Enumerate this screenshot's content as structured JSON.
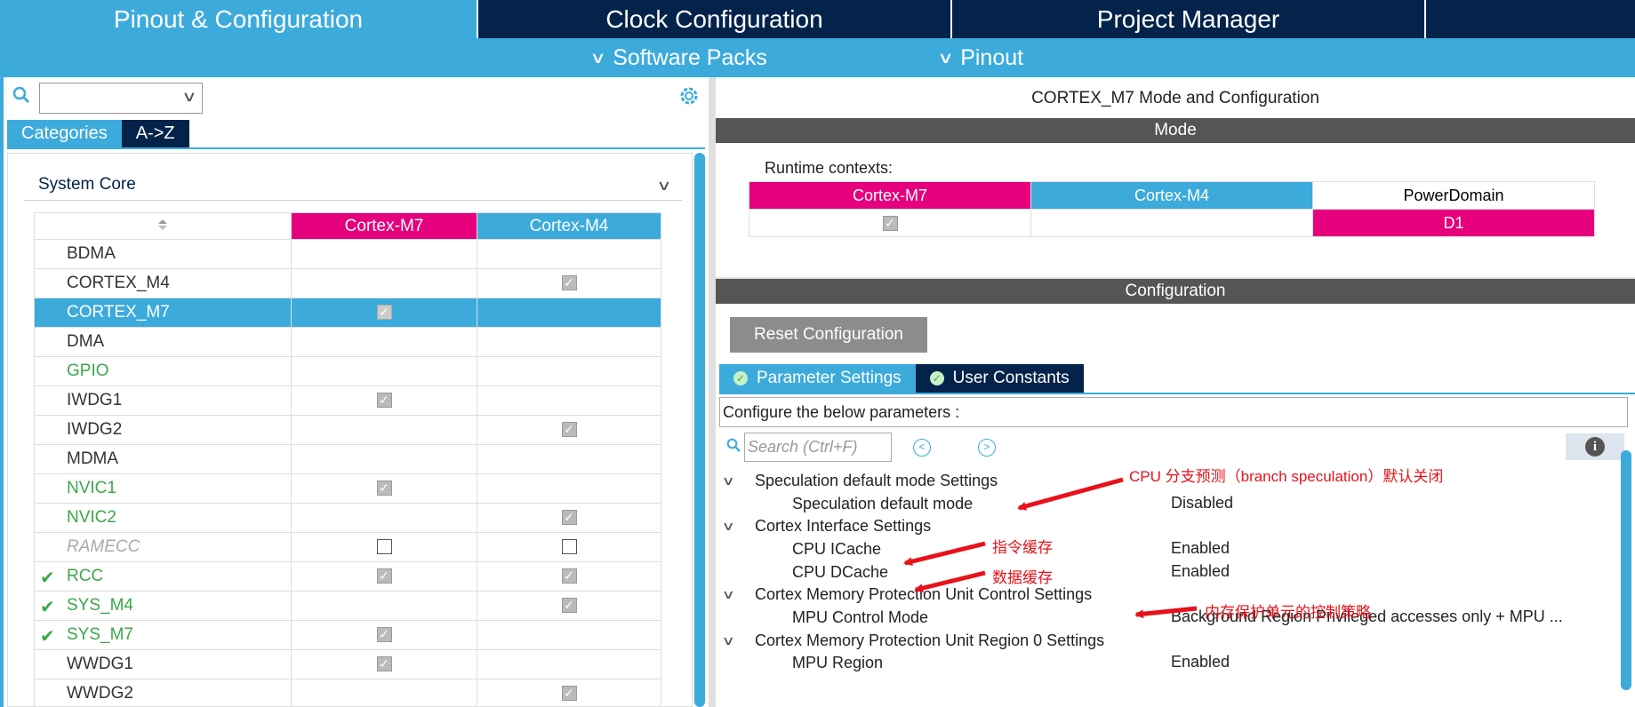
{
  "top_tabs": [
    "Pinout & Configuration",
    "Clock Configuration",
    "Project Manager",
    ""
  ],
  "sub_menu": [
    "Software Packs",
    "Pinout"
  ],
  "left": {
    "search_value": "",
    "category_tabs": [
      "Categories",
      "A->Z"
    ],
    "group": "System Core",
    "table_headers": [
      "Cortex-M7",
      "Cortex-M4"
    ],
    "rows": [
      {
        "name": "BDMA",
        "m7": "",
        "m4": "",
        "status": "normal",
        "tick": false
      },
      {
        "name": "CORTEX_M4",
        "m7": "",
        "m4": "checked",
        "status": "normal",
        "tick": false
      },
      {
        "name": "CORTEX_M7",
        "m7": "checked",
        "m4": "",
        "status": "selected",
        "tick": false
      },
      {
        "name": "DMA",
        "m7": "",
        "m4": "",
        "status": "normal",
        "tick": false
      },
      {
        "name": "GPIO",
        "m7": "",
        "m4": "",
        "status": "green",
        "tick": false
      },
      {
        "name": "IWDG1",
        "m7": "checked",
        "m4": "",
        "status": "normal",
        "tick": false
      },
      {
        "name": "IWDG2",
        "m7": "",
        "m4": "checked",
        "status": "normal",
        "tick": false
      },
      {
        "name": "MDMA",
        "m7": "",
        "m4": "",
        "status": "normal",
        "tick": false
      },
      {
        "name": "NVIC1",
        "m7": "checked",
        "m4": "",
        "status": "green",
        "tick": false
      },
      {
        "name": "NVIC2",
        "m7": "",
        "m4": "checked",
        "status": "green",
        "tick": false
      },
      {
        "name": "RAMECC",
        "m7": "unchecked",
        "m4": "unchecked",
        "status": "grey",
        "tick": false
      },
      {
        "name": "RCC",
        "m7": "checked",
        "m4": "checked",
        "status": "green",
        "tick": true
      },
      {
        "name": "SYS_M4",
        "m7": "",
        "m4": "checked",
        "status": "green",
        "tick": true
      },
      {
        "name": "SYS_M7",
        "m7": "checked",
        "m4": "",
        "status": "green",
        "tick": true
      },
      {
        "name": "WWDG1",
        "m7": "checked",
        "m4": "",
        "status": "normal",
        "tick": false
      },
      {
        "name": "WWDG2",
        "m7": "",
        "m4": "checked",
        "status": "normal",
        "tick": false
      }
    ]
  },
  "right": {
    "title": "CORTEX_M7 Mode and Configuration",
    "mode_header": "Mode",
    "runtime_label": "Runtime contexts:",
    "runtime_headers": [
      "Cortex-M7",
      "Cortex-M4",
      "PowerDomain"
    ],
    "runtime_values": [
      "checked",
      "",
      "D1"
    ],
    "config_header": "Configuration",
    "reset_button": "Reset Configuration",
    "param_tabs": [
      "Parameter Settings",
      "User Constants"
    ],
    "configure_text": "Configure the below parameters :",
    "search_placeholder": "Search (Ctrl+F)",
    "tree": [
      {
        "label": "Speculation default mode Settings",
        "value": "",
        "level": 0
      },
      {
        "label": "Speculation default mode",
        "value": "Disabled",
        "level": 1
      },
      {
        "label": "Cortex Interface Settings",
        "value": "",
        "level": 0
      },
      {
        "label": "CPU ICache",
        "value": "Enabled",
        "level": 1
      },
      {
        "label": "CPU DCache",
        "value": "Enabled",
        "level": 1
      },
      {
        "label": "Cortex Memory Protection Unit Control Settings",
        "value": "",
        "level": 0
      },
      {
        "label": "MPU Control Mode",
        "value": "Background Region Privileged accesses only + MPU ...",
        "level": 1
      },
      {
        "label": "Cortex Memory Protection Unit Region 0 Settings",
        "value": "",
        "level": 0
      },
      {
        "label": "MPU Region",
        "value": "Enabled",
        "level": 1
      }
    ]
  },
  "annotations": [
    "CPU 分支预测（branch speculation）默认关闭",
    "指令缓存",
    "数据缓存",
    "内存保护单元的控制策略"
  ],
  "colors": {
    "navy": "#03234b",
    "blue": "#3cabdc",
    "magenta": "#e6007e",
    "green": "#3aa84a",
    "red": "#e8121a"
  }
}
